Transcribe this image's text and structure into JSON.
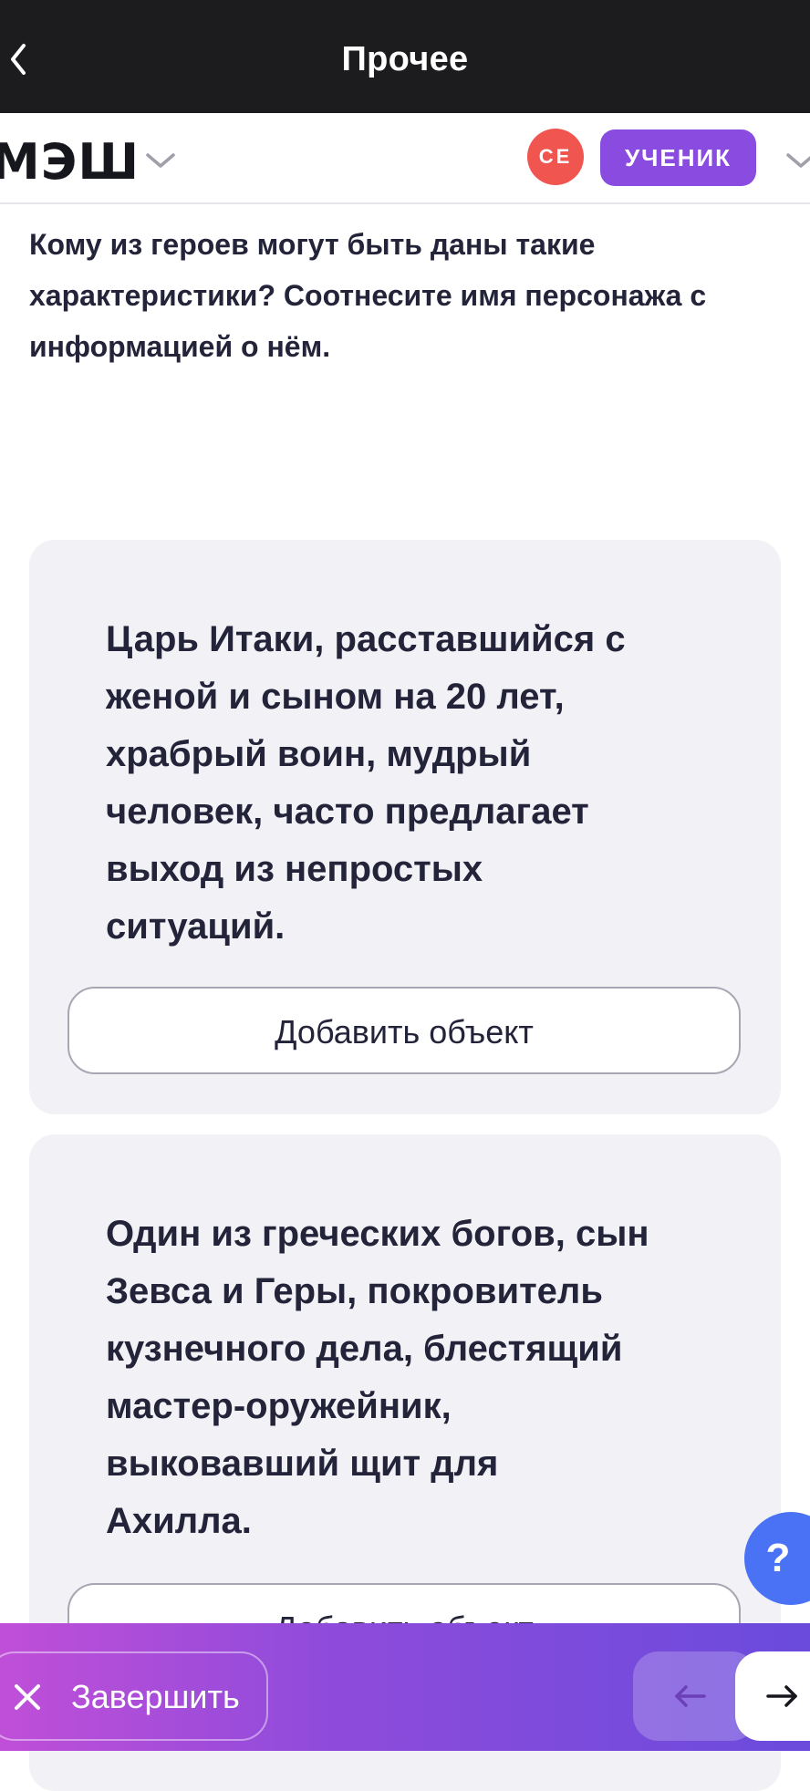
{
  "topbar": {
    "title": "Прочее"
  },
  "header": {
    "logo": "МЭШ",
    "avatar_initials": "СЕ",
    "role": "УЧЕНИК"
  },
  "question": "Кому из героев могут быть даны такие характеристики? Соотнесите имя персонажа с информацией о нём.",
  "cards": [
    {
      "text": "Царь Итаки, расставшийся с женой и сыном на 20 лет, храбрый воин, мудрый человек, часто предлагает выход из непростых ситуаций.",
      "add_label": "Добавить объект"
    },
    {
      "text": "Один из греческих богов, сын Зевса и Геры, покровитель кузнечного дела, блестящий мастер-оружейник, выковавший щит для Ахилла.",
      "add_label": "Добавить объект"
    }
  ],
  "help_label": "?",
  "bottom": {
    "finish_label": "Завершить"
  },
  "colors": {
    "accent": "#8a4be0",
    "avatar": "#f0554f",
    "help": "#4a72f5"
  }
}
